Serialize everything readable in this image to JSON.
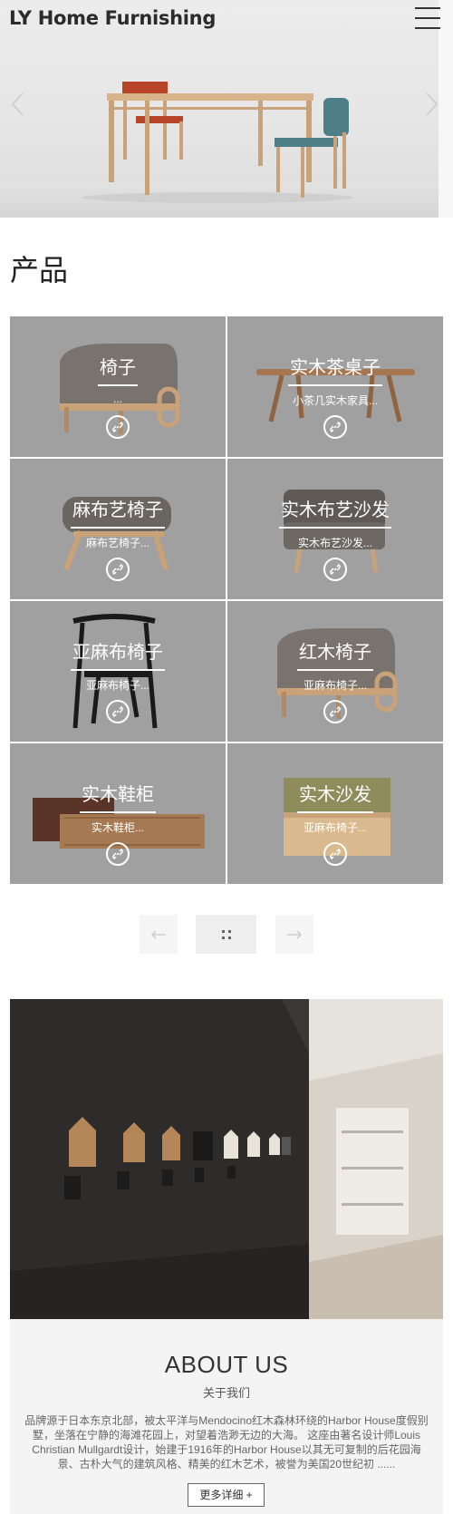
{
  "header": {
    "logo": "LY Home Furnishing",
    "menu_icon": "hamburger-menu-icon"
  },
  "hero": {
    "prev_icon": "chevron-left-icon",
    "next_icon": "chevron-right-icon"
  },
  "products": {
    "title": "产品",
    "items": [
      {
        "name": "椅子",
        "desc": "..."
      },
      {
        "name": "实木茶桌子",
        "desc": "小茶几实木家具..."
      },
      {
        "name": "麻布艺椅子",
        "desc": "麻布艺椅子..."
      },
      {
        "name": "实木布艺沙发",
        "desc": "实木布艺沙发..."
      },
      {
        "name": "亚麻布椅子",
        "desc": "亚麻布椅子..."
      },
      {
        "name": "红木椅子",
        "desc": "亚麻布椅子..."
      },
      {
        "name": "实木鞋柜",
        "desc": "实木鞋柜..."
      },
      {
        "name": "实木沙发",
        "desc": "亚麻布椅子..."
      }
    ],
    "item_icon": "link-icon"
  },
  "pager": {
    "prev_icon": "arrow-left-icon",
    "grid_icon": "grid-icon",
    "next_icon": "arrow-right-icon"
  },
  "about": {
    "title": "ABOUT US",
    "subtitle": "关于我们",
    "text": "品牌源于日本东京北部，被太平洋与Mendocino红木森林环绕的Harbor House度假别墅，坐落在宁静的海滩花园上，对望着浩渺无边的大海。 这座由著名设计师Louis Christian Mullgardt设计，始建于1916年的Harbor House以其无可复制的后花园海景、古朴大气的建筑风格、精美的红木艺术，被誉为美国20世纪初 ......",
    "more_label": "更多详细 +"
  },
  "colors": {
    "tile_bg": "#a0a0a0",
    "text_dark": "#333333",
    "about_bg": "#f4f4f4"
  }
}
